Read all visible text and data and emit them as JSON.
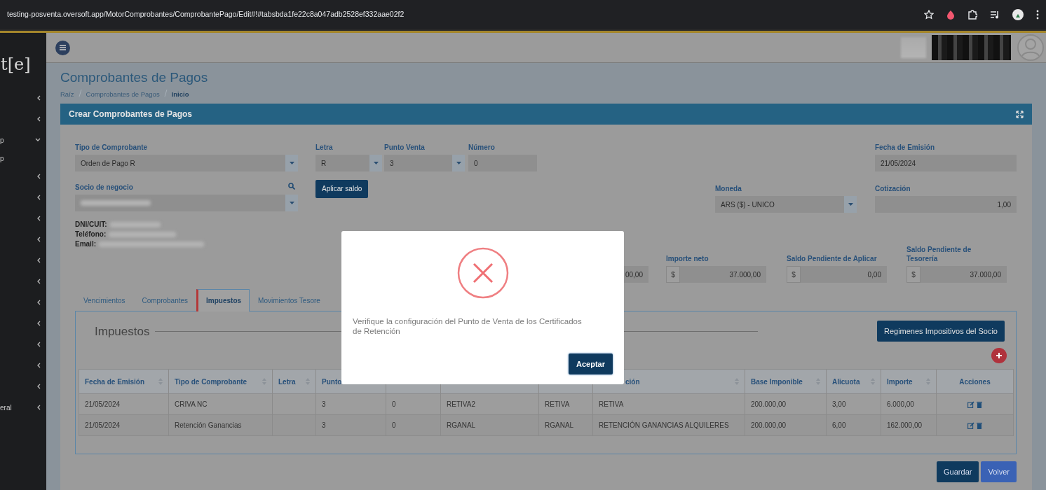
{
  "browser": {
    "url": "testing-posventa.oversoft.app/MotorComprobantes/ComprobantePago/Edit#!#tabsbda1fe22c8a047adb2528ef332aae02f2"
  },
  "sidebar": {
    "logo": "t[e]",
    "items": [
      {
        "expanded": false
      },
      {
        "expanded": false
      },
      {
        "label": "p",
        "expanded": true
      },
      {
        "label": "p"
      },
      {
        "expanded": false
      },
      {
        "expanded": false
      },
      {
        "expanded": false
      },
      {
        "expanded": false
      },
      {
        "expanded": false
      },
      {
        "expanded": false
      },
      {
        "expanded": false
      },
      {
        "expanded": false
      },
      {
        "expanded": false
      },
      {
        "expanded": false
      },
      {
        "expanded": false
      },
      {
        "label": "eral",
        "expanded": false
      }
    ]
  },
  "page": {
    "title": "Comprobantes de Pagos",
    "breadcrumb": [
      {
        "label": "Raíz",
        "selected": false
      },
      {
        "label": "Comprobantes de Pagos",
        "selected": false
      },
      {
        "label": "Inicio",
        "selected": true
      }
    ]
  },
  "panel": {
    "title": "Crear Comprobantes de Pagos",
    "fields": [
      {
        "kind": "select",
        "label": "Tipo de Comprobante",
        "value": "Orden de Pago R"
      },
      {
        "kind": "select",
        "label": "Letra",
        "value": "R"
      },
      {
        "kind": "select",
        "label": "Punto Venta",
        "value": "3"
      },
      {
        "kind": "input",
        "label": "Número",
        "value": "0"
      },
      {
        "kind": "input",
        "label": "Fecha de Emisión",
        "value": "21/05/2024"
      },
      {
        "kind": "search_select",
        "label": "Socio de negocio",
        "blurred": true
      },
      {
        "kind": "button",
        "label": "Aplicar saldo"
      },
      {
        "kind": "select",
        "label": "Moneda",
        "value": "ARS ($) - UNICO"
      },
      {
        "kind": "number",
        "label": "Cotización",
        "value": "1,00"
      }
    ],
    "contact": [
      {
        "label": "DNI/CUIT:",
        "blurred": true
      },
      {
        "label": "Teléfono:",
        "blurred": true
      },
      {
        "label": "Email:",
        "blurred": true
      }
    ],
    "amounts": [
      {
        "kind": "number",
        "value": "00,00"
      },
      {
        "kind": "money",
        "label": "Importe neto",
        "prefix": "$",
        "value": "37.000,00"
      },
      {
        "kind": "money",
        "label": "Saldo Pendiente de Aplicar",
        "prefix": "$",
        "value": "0,00"
      },
      {
        "kind": "money",
        "label": "Saldo Pendiente de Tesorería",
        "prefix": "$",
        "value": "37.000,00"
      }
    ],
    "tabs": [
      {
        "label": "Vencimientos",
        "selected": false
      },
      {
        "label": "Comprobantes",
        "selected": false
      },
      {
        "label": "Impuestos",
        "selected": true
      },
      {
        "label": "Movimientos Tesore",
        "selected": false
      }
    ],
    "section": {
      "title": "Impuestos",
      "button": "Regimenes Impositivos del Socio"
    },
    "table": {
      "columns": [
        {
          "label": "Fecha de Emisión",
          "sortable": true
        },
        {
          "label": "Tipo de Comprobante",
          "sortable": true
        },
        {
          "label": "Letra",
          "sortable": true
        },
        {
          "label": "Punto"
        },
        null,
        null,
        null,
        {
          "label": "ción",
          "sortable": true
        },
        {
          "label": "Base Imponible",
          "sortable": true
        },
        {
          "label": "Alicuota",
          "sortable": true
        },
        {
          "label": "Importe",
          "sortable": true
        },
        {
          "label": "Acciones",
          "sortable": false
        }
      ],
      "rows": [
        [
          "21/05/2024",
          "CRIVA NC",
          null,
          "3",
          "0",
          "RETIVA2",
          "RETIVA",
          "RETIVA",
          "200.000,00",
          "3,00",
          "6.000,00"
        ],
        [
          "21/05/2024",
          "Retención Ganancias",
          null,
          "3",
          "0",
          "RGANAL",
          "RGANAL",
          "RETENCIÓN GANANCIAS ALQUILERES",
          "200.000,00",
          "6,00",
          "162.000,00"
        ]
      ]
    },
    "buttons": [
      {
        "kind": "primary",
        "label": "Guardar"
      },
      {
        "kind": "secondary",
        "label": "Volver"
      }
    ]
  },
  "modal": {
    "kind": "error",
    "message": "Verifique la configuración del Punto de Venta de los Certificados de Retención",
    "button": "Aceptar"
  }
}
